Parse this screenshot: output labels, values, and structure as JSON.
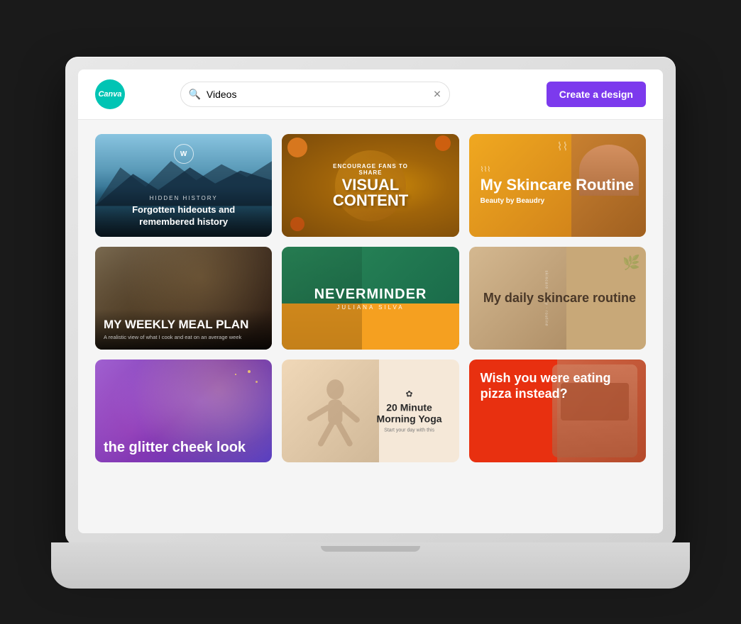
{
  "app": {
    "name": "Canva",
    "logo_text": "Canva"
  },
  "header": {
    "search": {
      "value": "Videos",
      "placeholder": "Search"
    },
    "create_button_label": "Create a design"
  },
  "grid": {
    "cards": [
      {
        "id": "card-1",
        "type": "mountains",
        "subtitle": "Hidden History",
        "title": "Forgotten hideouts and remembered history",
        "watermark": "W",
        "bg_color": "#5a9ab8"
      },
      {
        "id": "card-2",
        "type": "pie",
        "encourage": "Encourage fans to share",
        "title": "VISUAL CONTENT",
        "bg_color": "#c8860a"
      },
      {
        "id": "card-3",
        "type": "skincare-routine",
        "swirl": "⌇⌇⌇",
        "title": "My Skincare Routine",
        "subtitle": "Beauty by Beaudry",
        "bg_color": "#e8a020"
      },
      {
        "id": "card-4",
        "type": "meal-plan",
        "title": "MY WEEKLY MEAL PLAN",
        "subtitle": "A realistic view of what I cook and eat on an average week",
        "bg_color": "#3a2a18"
      },
      {
        "id": "card-5",
        "type": "neverminder",
        "title": "NEVERMINDER",
        "subtitle": "JULIANA SILVA",
        "top_color": "#1a6b4a",
        "bottom_color": "#f5a020"
      },
      {
        "id": "card-6",
        "type": "daily-skincare",
        "title": "My daily skincare routine",
        "bg_color": "#c8a878"
      },
      {
        "id": "card-7",
        "type": "glitter",
        "title": "the glitter cheek look",
        "bg_color": "#7030b0"
      },
      {
        "id": "card-8",
        "type": "yoga",
        "lotus": "✿",
        "title": "20 Minute Morning Yoga",
        "subtitle": "Start your day with this",
        "bg_color": "#f5e8d8"
      },
      {
        "id": "card-9",
        "type": "pizza",
        "title": "Wish you were eating pizza instead?",
        "bg_color": "#e83010"
      }
    ]
  }
}
